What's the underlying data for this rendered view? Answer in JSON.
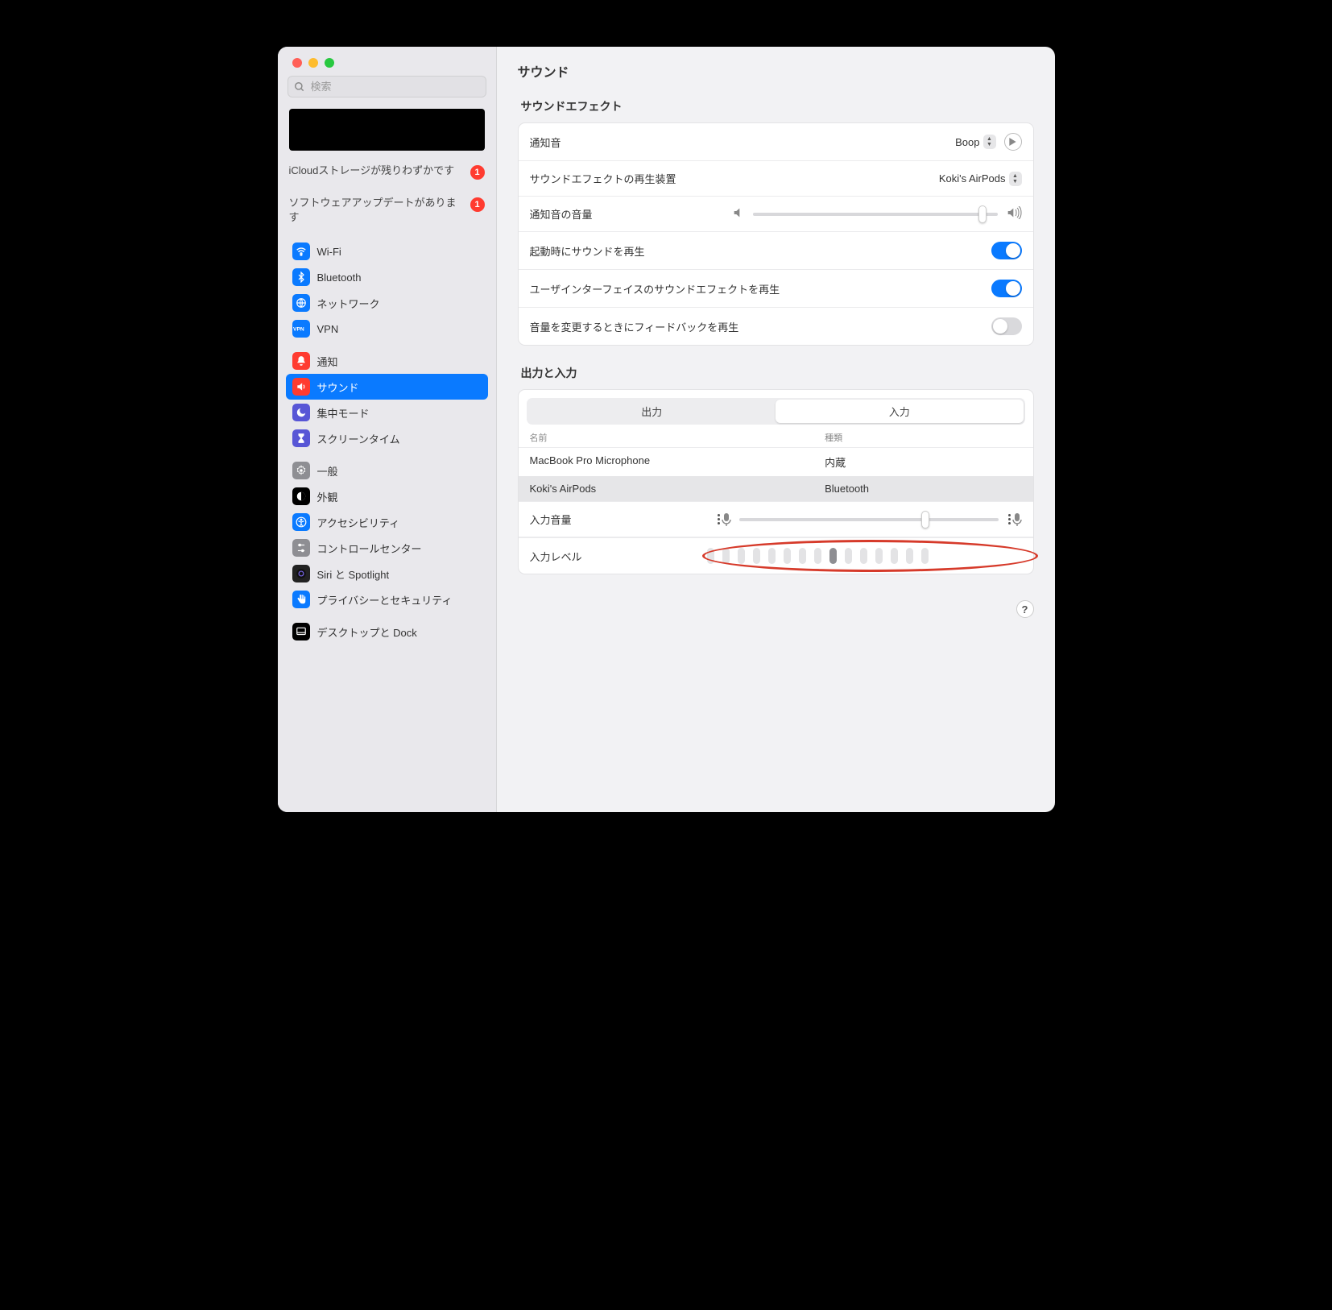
{
  "search": {
    "placeholder": "検索"
  },
  "notices": [
    {
      "text": "iCloudストレージが残りわずかです",
      "badge": "1"
    },
    {
      "text": "ソフトウェアアップデートがあります",
      "badge": "1"
    }
  ],
  "nav": {
    "groups": [
      [
        {
          "label": "Wi-Fi",
          "icon": "wifi",
          "bg": "#0a7aff"
        },
        {
          "label": "Bluetooth",
          "icon": "bluetooth",
          "bg": "#0a7aff"
        },
        {
          "label": "ネットワーク",
          "icon": "globe",
          "bg": "#0a7aff"
        },
        {
          "label": "VPN",
          "icon": "vpn",
          "bg": "#0a7aff"
        }
      ],
      [
        {
          "label": "通知",
          "icon": "bell",
          "bg": "#ff3b30"
        },
        {
          "label": "サウンド",
          "icon": "speaker",
          "bg": "#ff3b30",
          "selected": true
        },
        {
          "label": "集中モード",
          "icon": "moon",
          "bg": "#5856d6"
        },
        {
          "label": "スクリーンタイム",
          "icon": "hourglass",
          "bg": "#5856d6"
        }
      ],
      [
        {
          "label": "一般",
          "icon": "gear",
          "bg": "#8e8e93"
        },
        {
          "label": "外観",
          "icon": "appearance",
          "bg": "#000"
        },
        {
          "label": "アクセシビリティ",
          "icon": "accessibility",
          "bg": "#0a7aff"
        },
        {
          "label": "コントロールセンター",
          "icon": "controls",
          "bg": "#8e8e93"
        },
        {
          "label": "Siri と Spotlight",
          "icon": "siri",
          "bg": "#222"
        },
        {
          "label": "プライバシーとセキュリティ",
          "icon": "hand",
          "bg": "#0a7aff"
        }
      ],
      [
        {
          "label": "デスクトップと Dock",
          "icon": "dock",
          "bg": "#000"
        }
      ]
    ]
  },
  "main": {
    "title": "サウンド",
    "effects_title": "サウンドエフェクト",
    "rows": {
      "alert_sound": {
        "label": "通知音",
        "value": "Boop"
      },
      "playback_device": {
        "label": "サウンドエフェクトの再生装置",
        "value": "Koki's AirPods"
      },
      "alert_volume": {
        "label": "通知音の音量",
        "value_pct": 94
      },
      "startup_sound": {
        "label": "起動時にサウンドを再生",
        "on": true
      },
      "ui_effects": {
        "label": "ユーザインターフェイスのサウンドエフェクトを再生",
        "on": true
      },
      "volume_feedback": {
        "label": "音量を変更するときにフィードバックを再生",
        "on": false
      }
    },
    "io_title": "出力と入力",
    "tabs": {
      "output": "出力",
      "input": "入力",
      "selected": "input"
    },
    "device_headers": {
      "name": "名前",
      "type": "種類"
    },
    "devices": [
      {
        "name": "MacBook Pro Microphone",
        "type": "内蔵",
        "selected": false
      },
      {
        "name": "Koki's AirPods",
        "type": "Bluetooth",
        "selected": true
      }
    ],
    "input_volume": {
      "label": "入力音量",
      "value_pct": 72
    },
    "input_level": {
      "label": "入力レベル",
      "segments": 15,
      "active_index": 8
    },
    "help": "?"
  }
}
